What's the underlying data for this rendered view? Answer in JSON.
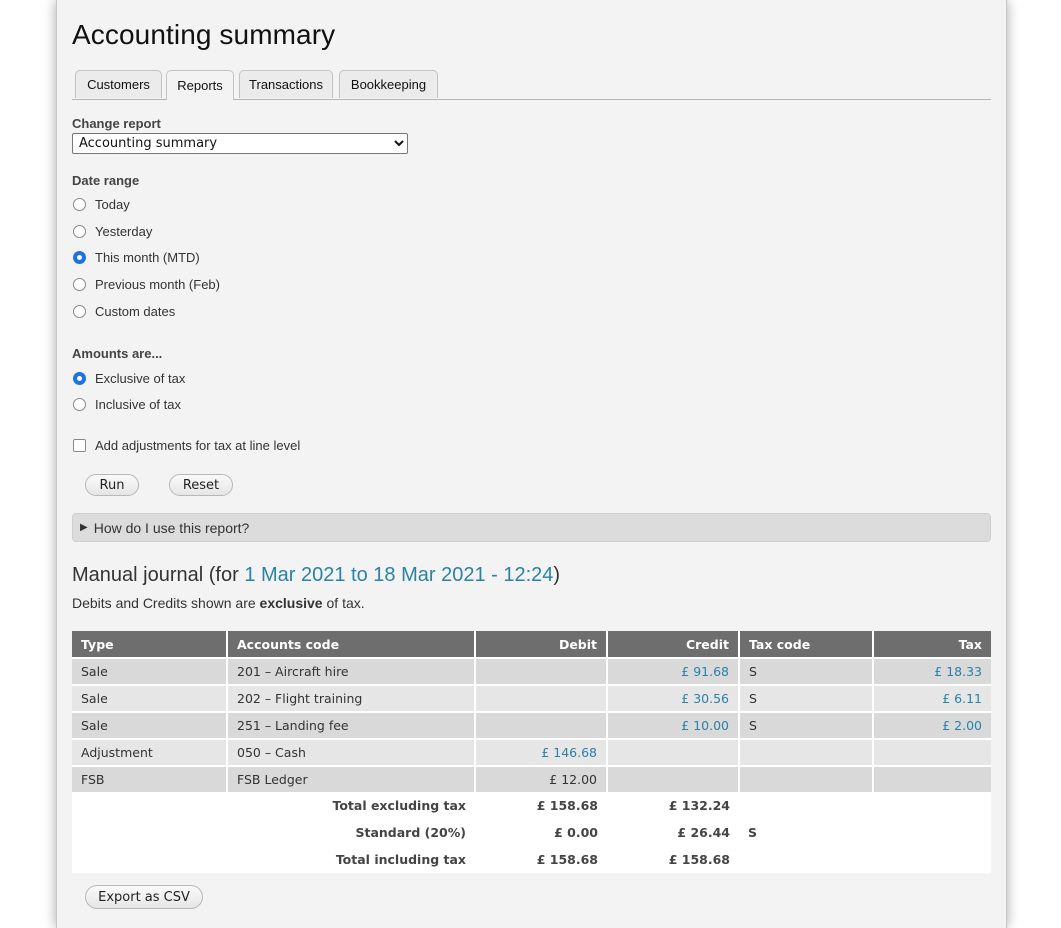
{
  "page": {
    "title": "Accounting summary",
    "tabs": [
      {
        "label": "Customers",
        "active": false
      },
      {
        "label": "Reports",
        "active": true
      },
      {
        "label": "Transactions",
        "active": false
      },
      {
        "label": "Bookkeeping",
        "active": false
      }
    ]
  },
  "form": {
    "change_report_label": "Change report",
    "report_selected": "Accounting summary",
    "date_range_label": "Date range",
    "date_range_options": [
      {
        "label": "Today",
        "checked": false
      },
      {
        "label": "Yesterday",
        "checked": false
      },
      {
        "label": "This month (MTD)",
        "checked": true
      },
      {
        "label": "Previous month (Feb)",
        "checked": false
      },
      {
        "label": "Custom dates",
        "checked": false
      }
    ],
    "amounts_label": "Amounts are...",
    "amounts_options": [
      {
        "label": "Exclusive of tax",
        "checked": true
      },
      {
        "label": "Inclusive of tax",
        "checked": false
      }
    ],
    "adjustments_checkbox": {
      "label": "Add adjustments for tax at line level",
      "checked": false
    },
    "run_label": "Run",
    "reset_label": "Reset"
  },
  "help": {
    "toggle_icon": "▶",
    "label": "How do I use this report?"
  },
  "report": {
    "heading_prefix": "Manual journal (for ",
    "heading_date": "1 Mar 2021 to 18 Mar 2021 - 12:24",
    "heading_suffix": ")",
    "note_prefix": "Debits and Credits shown are ",
    "note_bold": "exclusive",
    "note_suffix": " of tax.",
    "columns": [
      "Type",
      "Accounts code",
      "Debit",
      "Credit",
      "Tax code",
      "Tax"
    ],
    "rows": [
      {
        "type": "Sale",
        "code": "201 – Aircraft hire",
        "debit": "",
        "credit": "£ 91.68",
        "tax_code": "S",
        "tax": "£ 18.33"
      },
      {
        "type": "Sale",
        "code": "202 – Flight training",
        "debit": "",
        "credit": "£ 30.56",
        "tax_code": "S",
        "tax": "£ 6.11"
      },
      {
        "type": "Sale",
        "code": "251 – Landing fee",
        "debit": "",
        "credit": "£ 10.00",
        "tax_code": "S",
        "tax": "£ 2.00"
      },
      {
        "type": "Adjustment",
        "code": "050 – Cash",
        "debit": "£ 146.68",
        "credit": "",
        "tax_code": "",
        "tax": ""
      },
      {
        "type": "FSB",
        "code": "FSB Ledger",
        "debit": "£ 12.00",
        "credit": "",
        "tax_code": "",
        "tax": ""
      }
    ],
    "totals": [
      {
        "label": "Total excluding tax",
        "debit": "£ 158.68",
        "credit": "£ 132.24",
        "tax_code": ""
      },
      {
        "label": "Standard (20%)",
        "debit": "£ 0.00",
        "credit": "£ 26.44",
        "tax_code": "S"
      },
      {
        "label": "Total including tax",
        "debit": "£ 158.68",
        "credit": "£ 158.68",
        "tax_code": ""
      }
    ],
    "export_label": "Export as CSV"
  },
  "colors": {
    "link": "#2a82a8",
    "header_bg": "#6e6e6e",
    "radio_checked": "#1a73e8"
  }
}
